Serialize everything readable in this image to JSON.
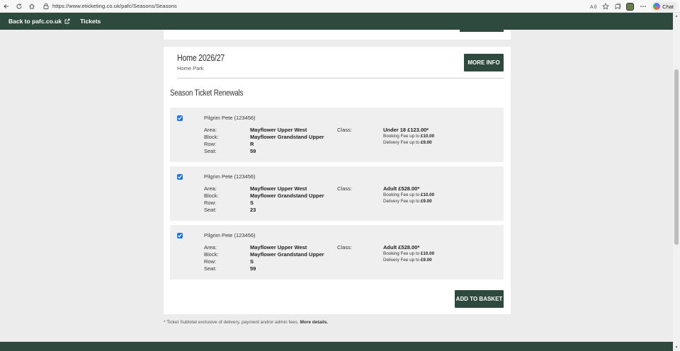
{
  "browser": {
    "url": "https://www.eticketing.co.uk/pafc/Seasons/Seasons",
    "chat_label": "Chat",
    "icons": {
      "back": "back-arrow-icon",
      "refresh": "refresh-icon",
      "home": "home-icon",
      "lock": "lock-icon",
      "read_aloud": "read-aloud-icon",
      "favorite": "star-icon",
      "collections": "collections-icon",
      "more": "more-icon",
      "copilot": "copilot-icon"
    }
  },
  "nav": {
    "back_label": "Back to pafc.co.uk",
    "tickets_label": "Tickets"
  },
  "season": {
    "title": "Home 2026/27",
    "venue": "Home Park",
    "more_info_label": "MORE INFO"
  },
  "renewals": {
    "title": "Season Ticket Renewals",
    "labels": {
      "area": "Area:",
      "block": "Block:",
      "row": "Row:",
      "seat": "Seat:",
      "class": "Class:"
    },
    "tickets": [
      {
        "checked": true,
        "holder": "Pilgrim Pete (123456)",
        "area": "Mayflower Upper West",
        "block": "Mayflower Grandstand Upper",
        "row": "R",
        "seat": "59",
        "price_line": "Under 18 £123.00*",
        "booking_fee_label": "Booking Fee up to ",
        "booking_fee": "£10.00",
        "delivery_fee_label": "Delivery Fee up to ",
        "delivery_fee": "£9.00"
      },
      {
        "checked": true,
        "holder": "Pilgrim Pete (123456)",
        "area": "Mayflower Upper West",
        "block": "Mayflower Grandstand Upper",
        "row": "S",
        "seat": "23",
        "price_line": "Adult £528.00*",
        "booking_fee_label": "Booking Fee up to ",
        "booking_fee": "£10.00",
        "delivery_fee_label": "Delivery Fee up to ",
        "delivery_fee": "£9.00"
      },
      {
        "checked": true,
        "holder": "Pilgrim Pete (123456)",
        "area": "Mayflower Upper West",
        "block": "Mayflower Grandstand Upper",
        "row": "S",
        "seat": "59",
        "price_line": "Adult £528.00*",
        "booking_fee_label": "Booking Fee up to ",
        "booking_fee": "£10.00",
        "delivery_fee_label": "Delivery Fee up to ",
        "delivery_fee": "£9.00"
      }
    ],
    "add_to_basket_label": "ADD TO BASKET"
  },
  "footnote": {
    "text": "* Ticket Subtotal exclusive of delivery, payment and/or admin fees. ",
    "link": "More details."
  },
  "colors": {
    "brand_green": "#2e4a3e",
    "page_bg": "#ececec",
    "ticket_bg": "#efefef"
  }
}
